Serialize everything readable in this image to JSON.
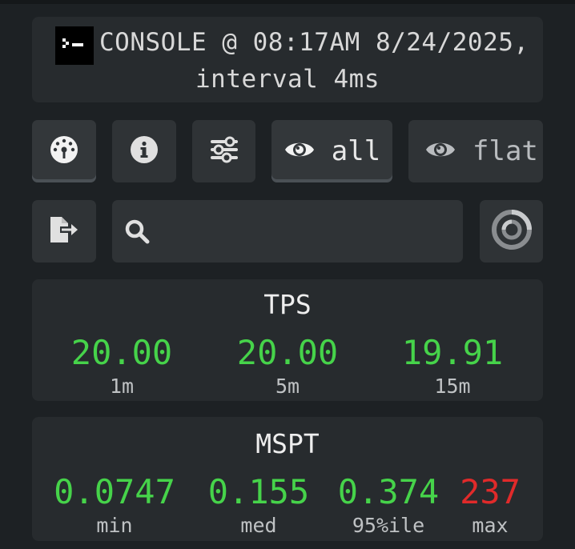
{
  "header": {
    "title_line1": "CONSOLE @ 08:17AM 8/24/2025,",
    "title_line2": "interval 4ms",
    "logo_icon": "terminal-icon"
  },
  "toolbar": {
    "buttons": [
      {
        "icon": "gauge-icon",
        "active": true
      },
      {
        "icon": "info-icon",
        "active": false
      },
      {
        "icon": "sliders-icon",
        "active": false
      },
      {
        "icon": "eye-icon",
        "label": "all",
        "active": true
      },
      {
        "icon": "eye-icon",
        "label": "flat",
        "active": false
      }
    ]
  },
  "row2": {
    "export_icon": "file-export-icon",
    "search_icon": "search-icon",
    "search_value": "",
    "search_placeholder": "",
    "spinner_icon": "loading-ring-icon"
  },
  "tps": {
    "title": "TPS",
    "values": [
      {
        "value": "20.00",
        "label": "1m"
      },
      {
        "value": "20.00",
        "label": "5m"
      },
      {
        "value": "19.91",
        "label": "15m"
      }
    ]
  },
  "mspt": {
    "title": "MSPT",
    "values": [
      {
        "value": "0.0747",
        "label": "min"
      },
      {
        "value": "0.155",
        "label": "med"
      },
      {
        "value": "0.374",
        "label": "95%ile"
      },
      {
        "value": "237",
        "label": "max"
      }
    ]
  },
  "colors": {
    "good": "#46d34a",
    "bad": "#e02a2a",
    "card": "#272b2e",
    "background": "#1d2124"
  }
}
